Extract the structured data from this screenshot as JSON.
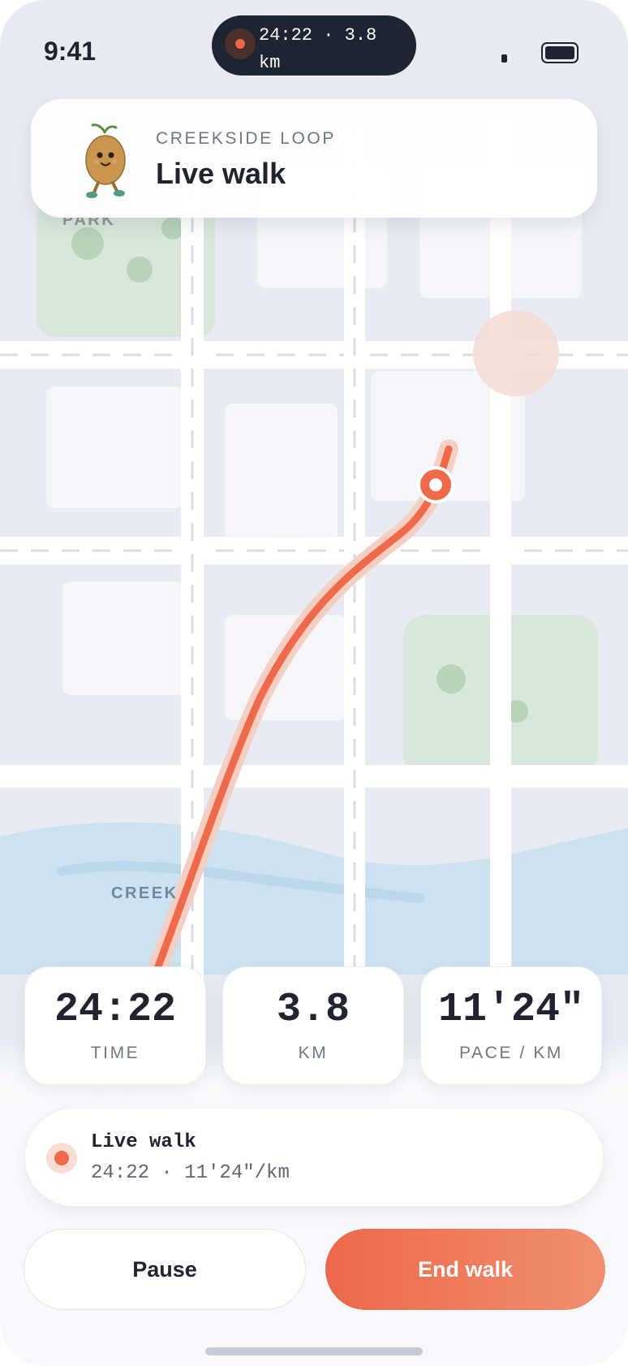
{
  "status_bar": {
    "time": "9:41"
  },
  "live_activity": {
    "text": "24:22 · 3.8 km"
  },
  "route_card": {
    "eyebrow": "CREEKSIDE LOOP",
    "title": "Live walk"
  },
  "map": {
    "labels": {
      "park": "PARK",
      "creek": "CREEK"
    }
  },
  "stats": [
    {
      "value": "24:22",
      "label": "TIME"
    },
    {
      "value": "3.8",
      "label": "KM"
    },
    {
      "value": "11'24\"",
      "label": "PACE / KM"
    }
  ],
  "live_bar": {
    "title": "Live walk",
    "subtitle": "24:22 · 11'24\"/km"
  },
  "buttons": {
    "pause": "Pause",
    "end": "End walk"
  },
  "colors": {
    "accent": "#ee6a4a",
    "map_background": "#e8ecf2",
    "park": "#d9e7da",
    "water": "#cde2f1",
    "text": "#1f2430"
  }
}
